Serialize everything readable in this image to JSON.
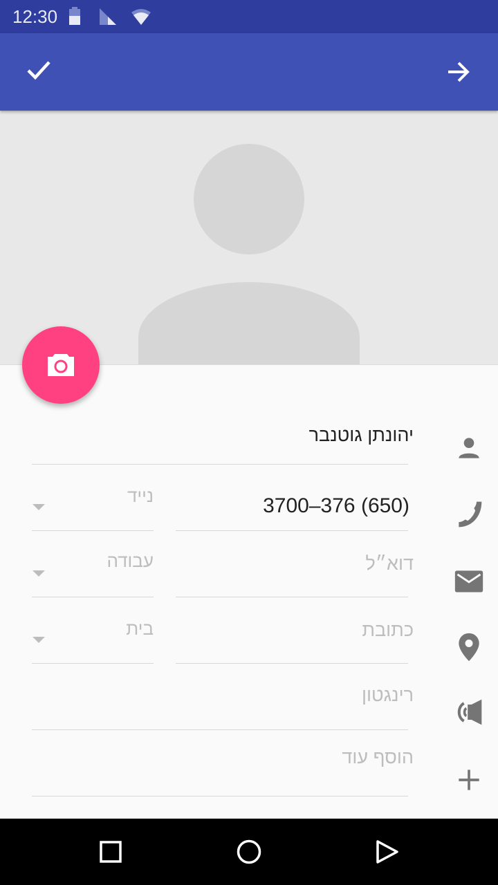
{
  "status_bar": {
    "time": "12:30",
    "icons": [
      "battery-icon",
      "signal-icon",
      "wifi-icon"
    ]
  },
  "app_bar": {
    "left_icon": "check-icon",
    "right_icon": "arrow-forward-icon"
  },
  "photo": {
    "placeholder": "person-silhouette",
    "fab_icon": "camera-icon",
    "fab_color": "#ff4081"
  },
  "form": {
    "name": {
      "value": "יהונתן גוטנבר"
    },
    "phone": {
      "value": "(650) 376‒3700",
      "type": "נייד"
    },
    "email": {
      "placeholder": "דוא״ל",
      "type": "עבודה"
    },
    "address": {
      "placeholder": "כתובת",
      "type": "בית"
    },
    "ringtone": {
      "placeholder": "רינגטון"
    },
    "add_more": {
      "placeholder": "הוסף עוד"
    }
  },
  "colors": {
    "primary": "#3f51b5",
    "primary_dark": "#2f3e9e",
    "accent": "#ff4081"
  }
}
